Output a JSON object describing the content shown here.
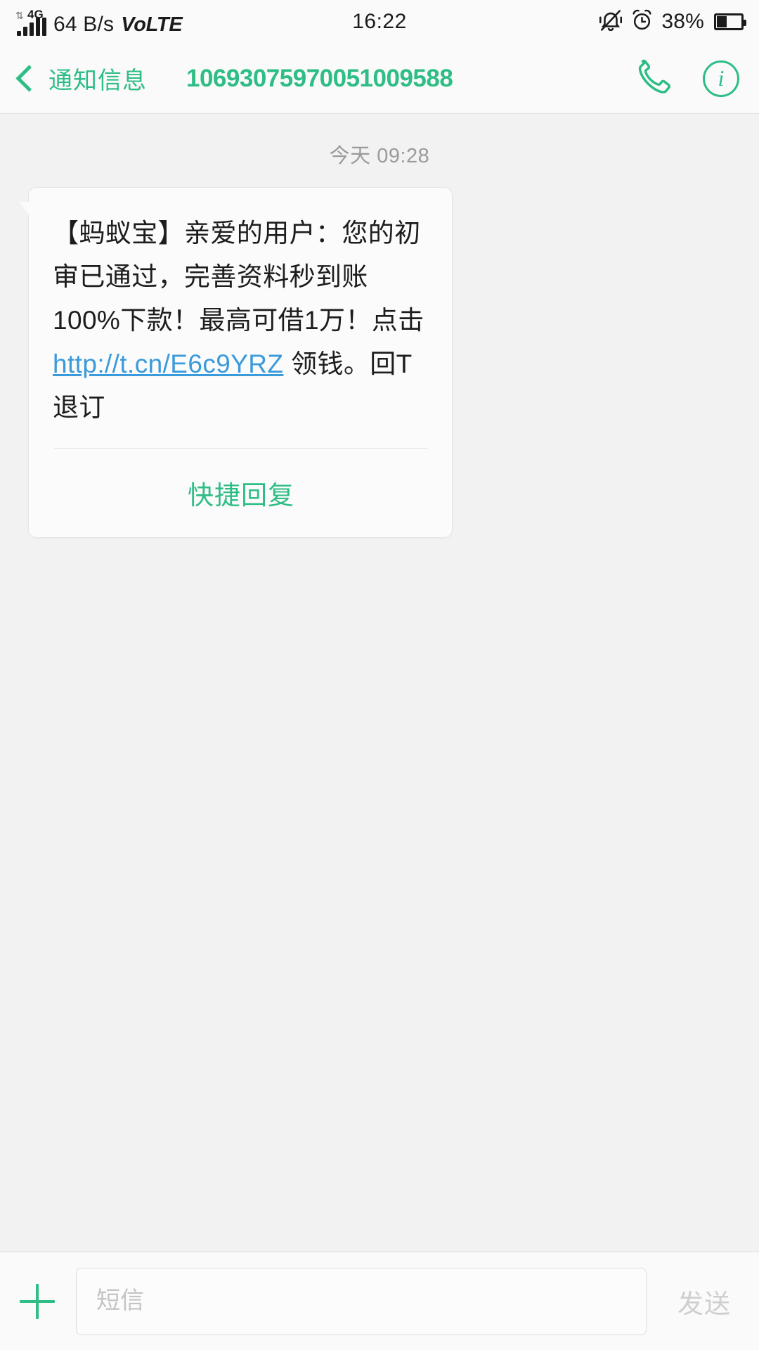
{
  "status_bar": {
    "network_type": "4G",
    "data_arrows": "⇅",
    "data_speed": "64 B/s",
    "volte_lo": "Vo",
    "volte_hi": "LTE",
    "time": "16:22",
    "battery_percent": "38%",
    "battery_level": 38,
    "icons": {
      "silent_bell": "bell-muted-icon",
      "alarm": "alarm-clock-icon",
      "battery": "battery-icon",
      "signal": "signal-bars-icon"
    }
  },
  "header": {
    "back_label": "通知信息",
    "thread_number": "10693075970051009588",
    "call_icon": "phone-icon",
    "info_icon": "info-icon",
    "info_glyph": "i",
    "accent_color": "#2ebd85"
  },
  "conversation": {
    "date_divider": "今天 09:28",
    "message": {
      "part1": "【蚂蚁宝】亲爱的用户：您的初审已通过，完善资料秒到账100%下款！最高可借1万！点击 ",
      "link_text": "http://t.cn/E6c9YRZ",
      "link_color": "#3a9ada",
      "part2": " 领钱。回T退订"
    },
    "quick_reply_label": "快捷回复"
  },
  "input_bar": {
    "add_icon": "plus-icon",
    "input_value": "",
    "input_placeholder": "短信",
    "send_label": "发送"
  }
}
